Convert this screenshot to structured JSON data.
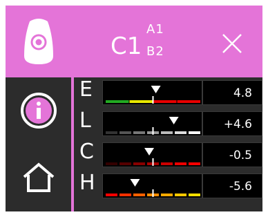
{
  "header": {
    "code": "C1",
    "sup": "A1",
    "sub": "B2"
  },
  "icons": {
    "sensor": "sensor-target-icon",
    "info": "info-icon",
    "home": "home-icon",
    "close": "close-icon"
  },
  "colors": {
    "accent": "#e474d8",
    "panel": "#2c2c2c"
  },
  "rows": [
    {
      "label": "E",
      "value": "4.8",
      "indicator": 0.53,
      "segments": [
        "#22aa22",
        "#e8e800",
        "#e80000",
        "#e80000"
      ]
    },
    {
      "label": "L",
      "value": "+4.6",
      "indicator": 0.72,
      "segments": [
        "#333333",
        "#555555",
        "#777777",
        "#999999",
        "#bbbbbb",
        "#dddddd",
        "#ffffff"
      ]
    },
    {
      "label": "C",
      "value": "-0.5",
      "indicator": 0.46,
      "segments": [
        "#330000",
        "#550000",
        "#880000",
        "#aa0000",
        "#cc0000",
        "#ee0000",
        "#ff0000"
      ]
    },
    {
      "label": "H",
      "value": "-5.6",
      "indicator": 0.31,
      "segments": [
        "#ff0000",
        "#ff3000",
        "#ff6000",
        "#ff8c00",
        "#ffaa00",
        "#ffc800",
        "#ffe000"
      ]
    }
  ]
}
